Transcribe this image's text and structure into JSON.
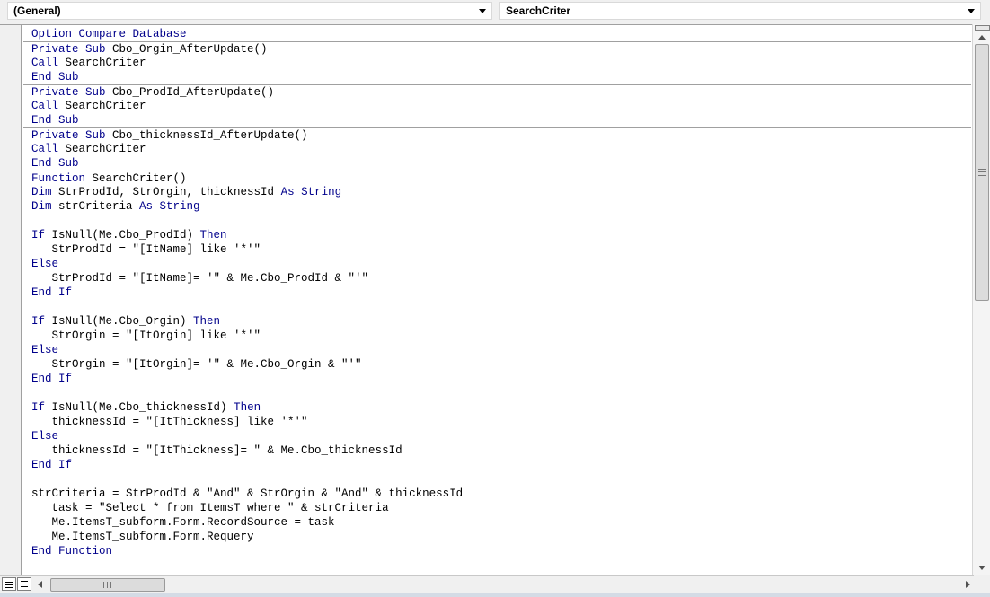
{
  "toolbar": {
    "object_combo": "(General)",
    "procedure_combo": "SearchCriter"
  },
  "code_lines": [
    [
      {
        "t": "Option Compare Database",
        "k": 1
      }
    ],
    [
      {
        "t": "Private Sub",
        "k": 1
      },
      {
        "t": " Cbo_Orgin_AfterUpdate()"
      }
    ],
    [
      {
        "t": "Call",
        "k": 1
      },
      {
        "t": " SearchCriter"
      }
    ],
    [
      {
        "t": "End Sub",
        "k": 1
      }
    ],
    [
      {
        "t": "Private Sub",
        "k": 1
      },
      {
        "t": " Cbo_ProdId_AfterUpdate()"
      }
    ],
    [
      {
        "t": "Call",
        "k": 1
      },
      {
        "t": " SearchCriter"
      }
    ],
    [
      {
        "t": "End Sub",
        "k": 1
      }
    ],
    [
      {
        "t": "Private Sub",
        "k": 1
      },
      {
        "t": " Cbo_thicknessId_AfterUpdate()"
      }
    ],
    [
      {
        "t": "Call",
        "k": 1
      },
      {
        "t": " SearchCriter"
      }
    ],
    [
      {
        "t": "End Sub",
        "k": 1
      }
    ],
    [
      {
        "t": "Function",
        "k": 1
      },
      {
        "t": " SearchCriter()"
      }
    ],
    [
      {
        "t": "Dim",
        "k": 1
      },
      {
        "t": " StrProdId, StrOrgin, thicknessId "
      },
      {
        "t": "As String",
        "k": 1
      }
    ],
    [
      {
        "t": "Dim",
        "k": 1
      },
      {
        "t": " strCriteria "
      },
      {
        "t": "As String",
        "k": 1
      }
    ],
    [
      {
        "t": ""
      }
    ],
    [
      {
        "t": "If",
        "k": 1
      },
      {
        "t": " IsNull(Me.Cbo_ProdId) "
      },
      {
        "t": "Then",
        "k": 1
      }
    ],
    [
      {
        "t": "   StrProdId = \"[ItName] like '*'\""
      }
    ],
    [
      {
        "t": "Else",
        "k": 1
      }
    ],
    [
      {
        "t": "   StrProdId = \"[ItName]= '\" & Me.Cbo_ProdId & \"'\""
      }
    ],
    [
      {
        "t": "End If",
        "k": 1
      }
    ],
    [
      {
        "t": ""
      }
    ],
    [
      {
        "t": "If",
        "k": 1
      },
      {
        "t": " IsNull(Me.Cbo_Orgin) "
      },
      {
        "t": "Then",
        "k": 1
      }
    ],
    [
      {
        "t": "   StrOrgin = \"[ItOrgin] like '*'\""
      }
    ],
    [
      {
        "t": "Else",
        "k": 1
      }
    ],
    [
      {
        "t": "   StrOrgin = \"[ItOrgin]= '\" & Me.Cbo_Orgin & \"'\""
      }
    ],
    [
      {
        "t": "End If",
        "k": 1
      }
    ],
    [
      {
        "t": ""
      }
    ],
    [
      {
        "t": "If",
        "k": 1
      },
      {
        "t": " IsNull(Me.Cbo_thicknessId) "
      },
      {
        "t": "Then",
        "k": 1
      }
    ],
    [
      {
        "t": "   thicknessId = \"[ItThickness] like '*'\""
      }
    ],
    [
      {
        "t": "Else",
        "k": 1
      }
    ],
    [
      {
        "t": "   thicknessId = \"[ItThickness]= \" & Me.Cbo_thicknessId"
      }
    ],
    [
      {
        "t": "End If",
        "k": 1
      }
    ],
    [
      {
        "t": ""
      }
    ],
    [
      {
        "t": "strCriteria = StrProdId & \"And\" & StrOrgin & \"And\" & thicknessId"
      }
    ],
    [
      {
        "t": "   task = \"Select * from ItemsT where \" & strCriteria"
      }
    ],
    [
      {
        "t": "   Me.ItemsT_subform.Form.RecordSource = task"
      }
    ],
    [
      {
        "t": "   Me.ItemsT_subform.Form.Requery"
      }
    ],
    [
      {
        "t": "End Function",
        "k": 1
      }
    ]
  ],
  "separator_lines": [
    1,
    4,
    7,
    10
  ]
}
